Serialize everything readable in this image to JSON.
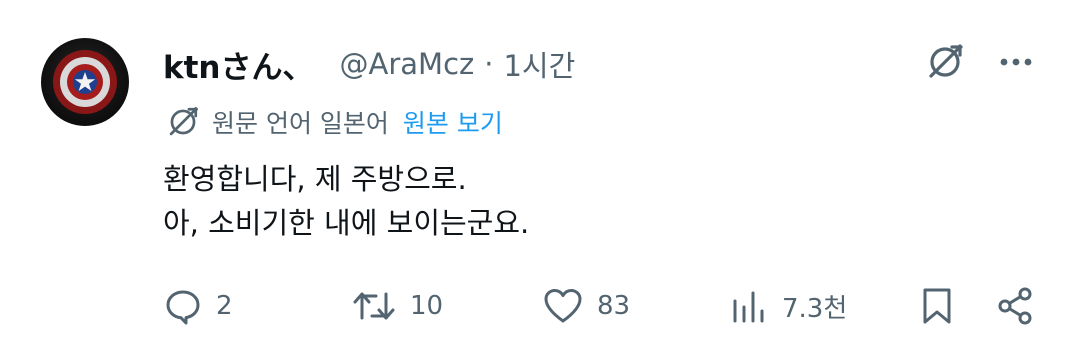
{
  "post": {
    "author": {
      "display_name": "ktnさん、",
      "handle": "@AraMcz",
      "separator": "·",
      "time": "1시간",
      "avatar_icon": "captain-america-shield-icon"
    },
    "translation": {
      "language_note": "원문 언어 일본어",
      "view_original": "원본 보기",
      "icon": "translate-icon"
    },
    "body_lines": [
      "환영합니다, 제 주방으로.",
      "아, 소비기한 내에 보이는군요."
    ],
    "actions": {
      "reply_count": "2",
      "repost_count": "10",
      "like_count": "83",
      "views_count": "7.3천"
    }
  },
  "colors": {
    "text": "#0f1419",
    "secondary": "#536471",
    "link": "#1d9bf0"
  }
}
